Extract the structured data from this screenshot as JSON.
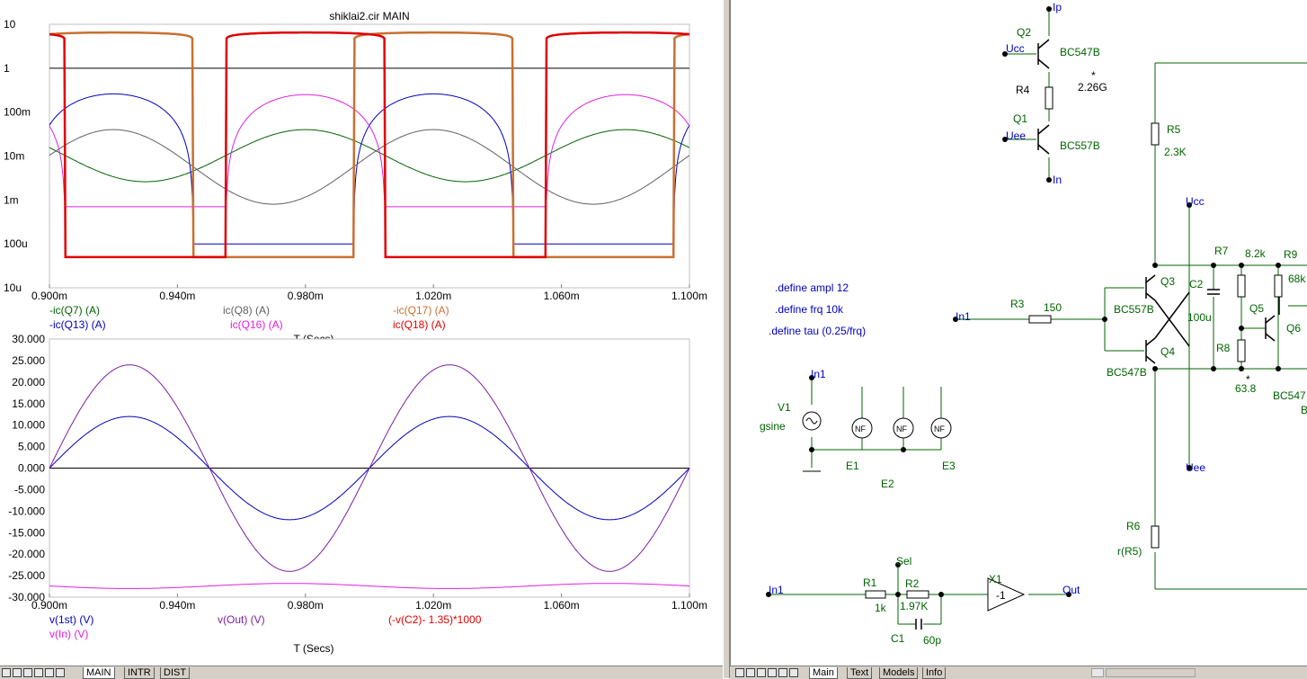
{
  "plot": {
    "title": "shiklai2.cir MAIN",
    "top": {
      "yticks": [
        "10",
        "1",
        "100m",
        "10m",
        "1m",
        "100u",
        "10u"
      ],
      "xticks": [
        "0.900m",
        "0.940m",
        "0.980m",
        "1.020m",
        "1.060m",
        "1.100m"
      ],
      "xlabel": "T (Secs)",
      "legend": [
        {
          "label": "-ic(Q7) (A)",
          "color": "#006400"
        },
        {
          "label": "-ic(Q13) (A)",
          "color": "#0000c0"
        },
        {
          "label": "ic(Q8) (A)",
          "color": "#606060"
        },
        {
          "label": "ic(Q16) (A)",
          "color": "#e020e0"
        },
        {
          "label": "-ic(Q17) (A)",
          "color": "#c87030"
        },
        {
          "label": "ic(Q18) (A)",
          "color": "#e00000"
        }
      ]
    },
    "bottom": {
      "yticks": [
        "30.000",
        "25.000",
        "20.000",
        "15.000",
        "10.000",
        "5.000",
        "0.000",
        "-5.000",
        "-10.000",
        "-15.000",
        "-20.000",
        "-25.000",
        "-30.000"
      ],
      "xticks": [
        "0.900m",
        "0.940m",
        "0.980m",
        "1.020m",
        "1.060m",
        "1.100m"
      ],
      "xlabel": "T (Secs)",
      "legend": [
        {
          "label": "v(1st) (V)",
          "color": "#0000c0"
        },
        {
          "label": "v(In) (V)",
          "color": "#e020e0"
        },
        {
          "label": "v(Out) (V)",
          "color": "#7b1fa2"
        },
        {
          "label": "(-v(C2)- 1.35)*1000",
          "color": "#e00000"
        }
      ]
    }
  },
  "chart_data": [
    {
      "type": "line",
      "title": "shiklai2.cir MAIN",
      "xlabel": "T (Secs)",
      "ylabel": "",
      "log_y": true,
      "xlim": [
        0.0009,
        0.0011
      ],
      "ylim": [
        1e-05,
        10
      ],
      "series": [
        {
          "name": "-ic(Q7) (A)",
          "shape": "sin",
          "amp_min": 0.0026,
          "amp_max": 0.04,
          "phase_peak": 0.00098
        },
        {
          "name": "-ic(Q13) (A)",
          "shape": "halfwave",
          "peak": 0.26,
          "peak_t": 0.00092,
          "floor": 0.0001
        },
        {
          "name": "ic(Q8) (A)",
          "shape": "sin",
          "amp_min": 0.0008,
          "amp_max": 0.04,
          "phase_peak": 0.00092
        },
        {
          "name": "ic(Q16) (A)",
          "shape": "halfwave",
          "peak": 0.25,
          "peak_t": 0.00098,
          "floor": 0.0007
        },
        {
          "name": "-ic(Q17) (A)",
          "shape": "rail",
          "peak": 6.5,
          "peak_t": 0.00092,
          "floor": 5e-05
        },
        {
          "name": "ic(Q18) (A)",
          "shape": "rail",
          "peak": 6.5,
          "peak_t": 0.00098,
          "floor": 5e-05
        }
      ],
      "reference_line": 1
    },
    {
      "type": "line",
      "title": "",
      "xlabel": "T (Secs)",
      "ylabel": "",
      "xlim": [
        0.0009,
        0.0011
      ],
      "ylim": [
        -30,
        30
      ],
      "series": [
        {
          "name": "v(1st) (V)",
          "amplitude": 12,
          "frequency": 10000
        },
        {
          "name": "v(In) (V)",
          "offset": -28,
          "amplitude": 1.2,
          "frequency": 10000
        },
        {
          "name": "v(Out) (V)",
          "amplitude": 24,
          "frequency": 10000
        },
        {
          "name": "(-v(C2)- 1.35)*1000",
          "offset": 0,
          "amplitude": 0,
          "frequency": 10000
        }
      ]
    }
  ],
  "schematic": {
    "labels": {
      "ip": "Ip",
      "in_node": "In",
      "ucc1": "Ucc",
      "uee1": "Uee",
      "q2": "Q2",
      "q2_model": "BC547B",
      "r4": "R4",
      "r4_val": "2.26G",
      "star1": "*",
      "q1": "Q1",
      "q1_model": "BC557B",
      "r5": "R5",
      "r5_val": "2.3K",
      "ucc2": "Ucc",
      "uee2": "Uee",
      "r7": "R7",
      "r7_val": "8.2k",
      "r9": "R9",
      "r9_val": "68k",
      "q3": "Q3",
      "c2": "C2",
      "c2_val": "100u",
      "q3_model": "BC557B",
      "r3": "R3",
      "r3_val": "150",
      "in1_a": "In1",
      "q5": "Q5",
      "q6": "Q6",
      "q4": "Q4",
      "q4_model": "BC547B",
      "r8": "R8",
      "r8_val": "63.8",
      "star2": "*",
      "q6_model": "BC547",
      "b_frag": "B",
      "r6": "R6",
      "r6_val": "r(R5)",
      "in1_b": "In1",
      "v1": "V1",
      "v1_type": "gsine",
      "e1": "E1",
      "e2": "E2",
      "e3": "E3",
      "nf": "NF",
      "sel": "Sel",
      "r1": "R1",
      "r1_val": "1k",
      "r2": "R2",
      "r2_val": "1.97K",
      "x1": "X1",
      "x1_gain": "-1",
      "out": "Out",
      "c1": "C1",
      "c1_val": "60p",
      "in1_c": "In1"
    },
    "defines": [
      ".define ampl 12",
      ".define frq 10k",
      ".define tau (0.25/frq)"
    ]
  },
  "tabs_left": [
    "MAIN",
    "INTR",
    "DIST"
  ],
  "tabs_right": [
    "Main",
    "Text",
    "Models",
    "Info"
  ]
}
